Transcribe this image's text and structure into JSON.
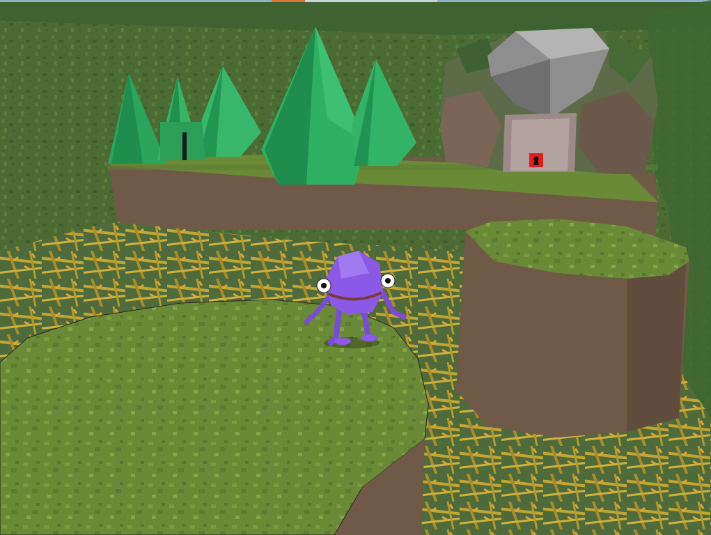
{
  "scene": {
    "type": "3d-platformer-view",
    "environment": "forest",
    "colors": {
      "grass_wall": "#4b6b33",
      "platform_top": "#6b8a37",
      "dirt_side": "#6f5a47",
      "tree": "#2aa55b",
      "thorns": "#b59b2e",
      "rock": "#8e8e8e",
      "door": "#9b8a88",
      "keyhole_panel": "#e21c1c",
      "character": "#8a59e6"
    }
  },
  "player": {
    "name": "purple-creature"
  },
  "objects": {
    "locked_door": {
      "icon": "keyhole-icon"
    },
    "trees": 6,
    "stump_platform": true
  }
}
